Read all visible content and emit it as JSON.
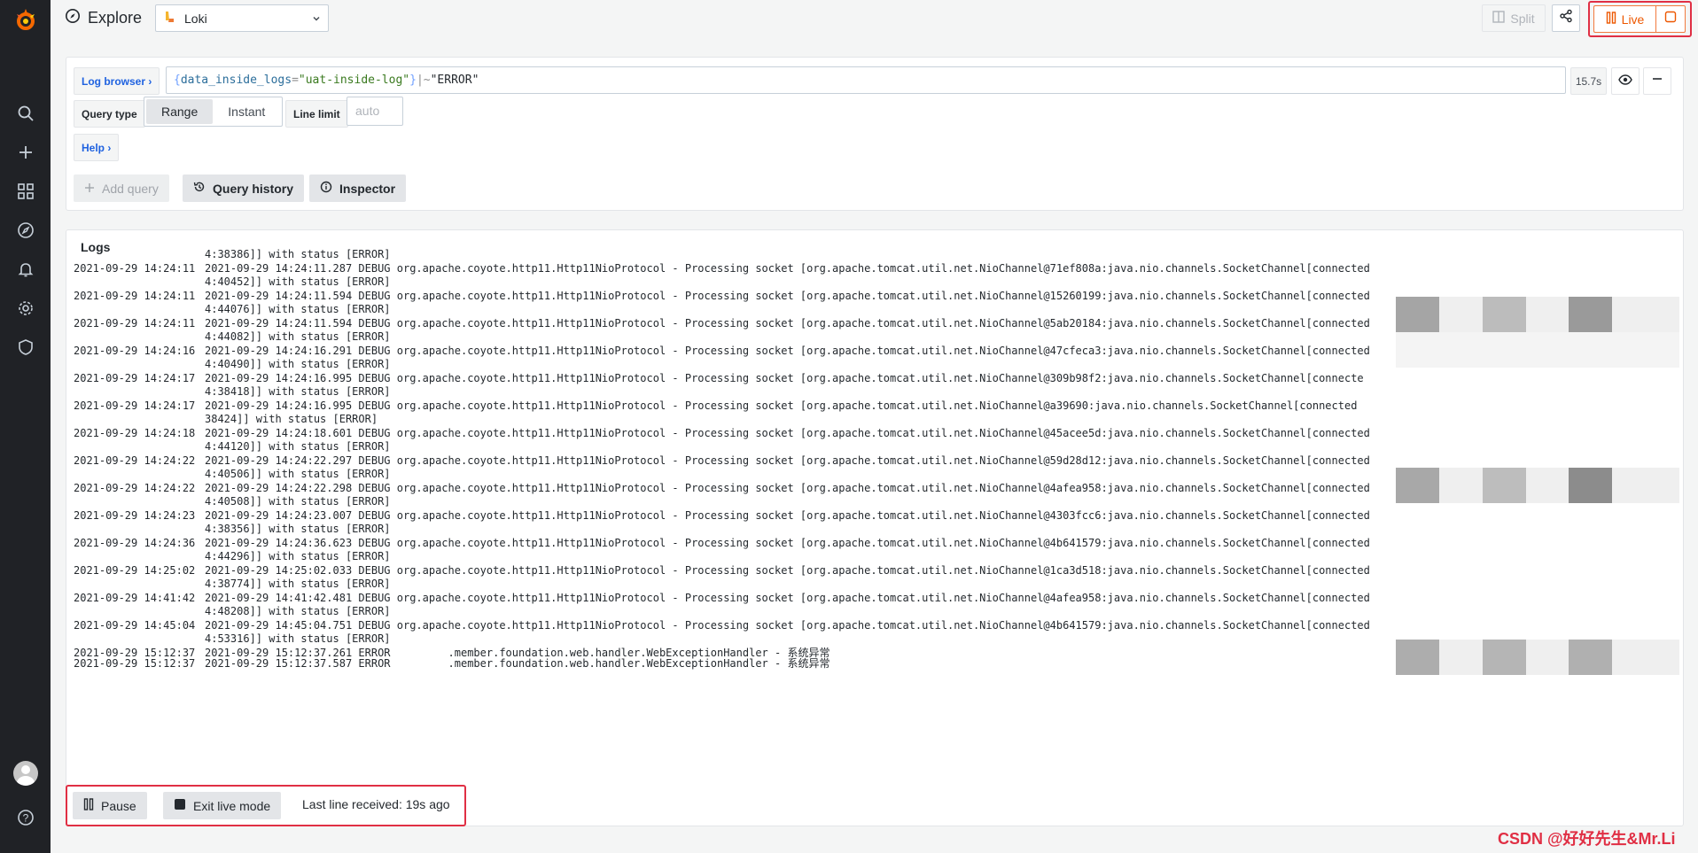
{
  "app": {
    "title": "Explore"
  },
  "datasource": {
    "name": "Loki"
  },
  "toolbar": {
    "split_label": "Split",
    "live_label": "Live"
  },
  "query": {
    "log_browser_label": "Log browser ›",
    "brace_open": "{",
    "label_key": "data_inside_logs",
    "eq": "=",
    "label_value": "\"uat-inside-log\"",
    "brace_close": "}",
    "operator": "|~",
    "filter": "\"ERROR\"",
    "time": "15.7s",
    "query_type_label": "Query type",
    "query_types": [
      "Range",
      "Instant"
    ],
    "line_limit_label": "Line limit",
    "line_limit_placeholder": "auto",
    "help_label": "Help ›"
  },
  "actions": {
    "add_query": "Add query",
    "query_history": "Query history",
    "inspector": "Inspector"
  },
  "logs": {
    "title": "Logs",
    "partial_top": "4:38386]] with status [ERROR]",
    "rows": [
      {
        "ts": "2021-09-29 14:24:11",
        "msg": "2021-09-29 14:24:11.287 DEBUG org.apache.coyote.http11.Http11NioProtocol - Processing socket [org.apache.tomcat.util.net.NioChannel@71ef808a:java.nio.channels.SocketChannel[connected",
        "cont": "4:40452]] with status [ERROR]"
      },
      {
        "ts": "2021-09-29 14:24:11",
        "msg": "2021-09-29 14:24:11.594 DEBUG org.apache.coyote.http11.Http11NioProtocol - Processing socket [org.apache.tomcat.util.net.NioChannel@15260199:java.nio.channels.SocketChannel[connected",
        "cont": "4:44076]] with status [ERROR]"
      },
      {
        "ts": "2021-09-29 14:24:11",
        "msg": "2021-09-29 14:24:11.594 DEBUG org.apache.coyote.http11.Http11NioProtocol - Processing socket [org.apache.tomcat.util.net.NioChannel@5ab20184:java.nio.channels.SocketChannel[connected",
        "cont": "4:44082]] with status [ERROR]"
      },
      {
        "ts": "2021-09-29 14:24:16",
        "msg": "2021-09-29 14:24:16.291 DEBUG org.apache.coyote.http11.Http11NioProtocol - Processing socket [org.apache.tomcat.util.net.NioChannel@47cfeca3:java.nio.channels.SocketChannel[connected",
        "cont": "4:40490]] with status [ERROR]"
      },
      {
        "ts": "2021-09-29 14:24:17",
        "msg": "2021-09-29 14:24:16.995 DEBUG org.apache.coyote.http11.Http11NioProtocol - Processing socket [org.apache.tomcat.util.net.NioChannel@309b98f2:java.nio.channels.SocketChannel[connecte",
        "cont": "4:38418]] with status [ERROR]"
      },
      {
        "ts": "2021-09-29 14:24:17",
        "msg": "2021-09-29 14:24:16.995 DEBUG org.apache.coyote.http11.Http11NioProtocol - Processing socket [org.apache.tomcat.util.net.NioChannel@a39690:java.nio.channels.SocketChannel[connected",
        "cont": "38424]] with status [ERROR]"
      },
      {
        "ts": "2021-09-29 14:24:18",
        "msg": "2021-09-29 14:24:18.601 DEBUG org.apache.coyote.http11.Http11NioProtocol - Processing socket [org.apache.tomcat.util.net.NioChannel@45acee5d:java.nio.channels.SocketChannel[connected",
        "cont": "4:44120]] with status [ERROR]"
      },
      {
        "ts": "2021-09-29 14:24:22",
        "msg": "2021-09-29 14:24:22.297 DEBUG org.apache.coyote.http11.Http11NioProtocol - Processing socket [org.apache.tomcat.util.net.NioChannel@59d28d12:java.nio.channels.SocketChannel[connected",
        "cont": "4:40506]] with status [ERROR]"
      },
      {
        "ts": "2021-09-29 14:24:22",
        "msg": "2021-09-29 14:24:22.298 DEBUG org.apache.coyote.http11.Http11NioProtocol - Processing socket [org.apache.tomcat.util.net.NioChannel@4afea958:java.nio.channels.SocketChannel[connected",
        "cont": "4:40508]] with status [ERROR]"
      },
      {
        "ts": "2021-09-29 14:24:23",
        "msg": "2021-09-29 14:24:23.007 DEBUG org.apache.coyote.http11.Http11NioProtocol - Processing socket [org.apache.tomcat.util.net.NioChannel@4303fcc6:java.nio.channels.SocketChannel[connected",
        "cont": "4:38356]] with status [ERROR]"
      },
      {
        "ts": "2021-09-29 14:24:36",
        "msg": "2021-09-29 14:24:36.623 DEBUG org.apache.coyote.http11.Http11NioProtocol - Processing socket [org.apache.tomcat.util.net.NioChannel@4b641579:java.nio.channels.SocketChannel[connected",
        "cont": "4:44296]] with status [ERROR]"
      },
      {
        "ts": "2021-09-29 14:25:02",
        "msg": "2021-09-29 14:25:02.033 DEBUG org.apache.coyote.http11.Http11NioProtocol - Processing socket [org.apache.tomcat.util.net.NioChannel@1ca3d518:java.nio.channels.SocketChannel[connected",
        "cont": "4:38774]] with status [ERROR]"
      },
      {
        "ts": "2021-09-29 14:41:42",
        "msg": "2021-09-29 14:41:42.481 DEBUG org.apache.coyote.http11.Http11NioProtocol - Processing socket [org.apache.tomcat.util.net.NioChannel@4afea958:java.nio.channels.SocketChannel[connected",
        "cont": "4:48208]] with status [ERROR]"
      },
      {
        "ts": "2021-09-29 14:45:04",
        "msg": "2021-09-29 14:45:04.751 DEBUG org.apache.coyote.http11.Http11NioProtocol - Processing socket [org.apache.tomcat.util.net.NioChannel@4b641579:java.nio.channels.SocketChannel[connected",
        "cont": "4:53316]] with status [ERROR]"
      },
      {
        "ts": "2021-09-29 15:12:37",
        "msg": "2021-09-29 15:12:37.261 ERROR         .member.foundation.web.handler.WebExceptionHandler - 系统异常",
        "cont": ""
      },
      {
        "ts": "2021-09-29 15:12:37",
        "msg": "2021-09-29 15:12:37.587 ERROR         .member.foundation.web.handler.WebExceptionHandler - 系统异常",
        "cont": ""
      }
    ]
  },
  "live_controls": {
    "pause_label": "Pause",
    "exit_label": "Exit live mode",
    "status": "Last line received: 19s ago"
  },
  "watermark": "CSDN @好好先生&Mr.Li",
  "colors": {
    "accent": "#ed5700",
    "highlight": "#e02f44",
    "link": "#1f62e0"
  }
}
